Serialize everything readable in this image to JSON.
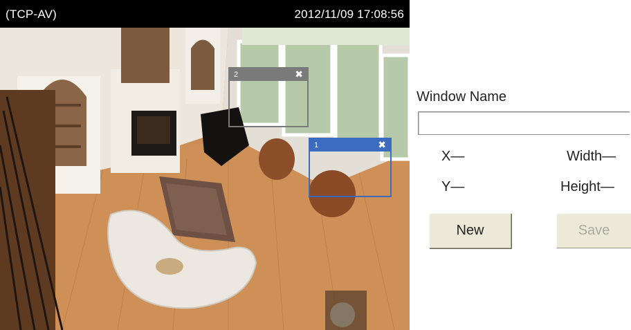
{
  "viewer": {
    "camera_name": "(TCP-AV)",
    "timestamp": "2012/11/09  17:08:56"
  },
  "motion_windows": [
    {
      "id": "2",
      "close_icon": "close-icon",
      "color": "#7a7a7a",
      "selected": false
    },
    {
      "id": "1",
      "close_icon": "close-icon",
      "color": "#3c6cc0",
      "selected": true
    }
  ],
  "panel": {
    "window_name_label": "Window Name",
    "window_name_value": "",
    "x_label": "X—",
    "width_label": "Width—",
    "y_label": "Y—",
    "height_label": "Height—",
    "new_button": "New",
    "save_button": "Save"
  },
  "colors": {
    "button_face": "#ece9d8",
    "disabled_text": "#a9a9a0",
    "selected_window": "#3c6cc0",
    "inactive_window": "#7a7a7a"
  }
}
